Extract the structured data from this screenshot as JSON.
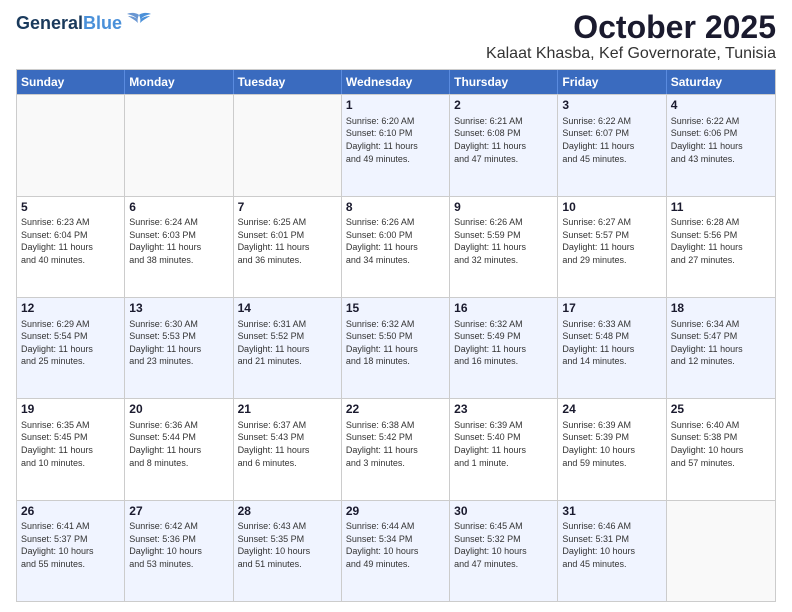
{
  "header": {
    "logo_line1": "General",
    "logo_line2": "Blue",
    "title": "October 2025",
    "subtitle": "Kalaat Khasba, Kef Governorate, Tunisia"
  },
  "calendar": {
    "weekdays": [
      "Sunday",
      "Monday",
      "Tuesday",
      "Wednesday",
      "Thursday",
      "Friday",
      "Saturday"
    ],
    "weeks": [
      [
        {
          "day": "",
          "info": ""
        },
        {
          "day": "",
          "info": ""
        },
        {
          "day": "",
          "info": ""
        },
        {
          "day": "1",
          "info": "Sunrise: 6:20 AM\nSunset: 6:10 PM\nDaylight: 11 hours\nand 49 minutes."
        },
        {
          "day": "2",
          "info": "Sunrise: 6:21 AM\nSunset: 6:08 PM\nDaylight: 11 hours\nand 47 minutes."
        },
        {
          "day": "3",
          "info": "Sunrise: 6:22 AM\nSunset: 6:07 PM\nDaylight: 11 hours\nand 45 minutes."
        },
        {
          "day": "4",
          "info": "Sunrise: 6:22 AM\nSunset: 6:06 PM\nDaylight: 11 hours\nand 43 minutes."
        }
      ],
      [
        {
          "day": "5",
          "info": "Sunrise: 6:23 AM\nSunset: 6:04 PM\nDaylight: 11 hours\nand 40 minutes."
        },
        {
          "day": "6",
          "info": "Sunrise: 6:24 AM\nSunset: 6:03 PM\nDaylight: 11 hours\nand 38 minutes."
        },
        {
          "day": "7",
          "info": "Sunrise: 6:25 AM\nSunset: 6:01 PM\nDaylight: 11 hours\nand 36 minutes."
        },
        {
          "day": "8",
          "info": "Sunrise: 6:26 AM\nSunset: 6:00 PM\nDaylight: 11 hours\nand 34 minutes."
        },
        {
          "day": "9",
          "info": "Sunrise: 6:26 AM\nSunset: 5:59 PM\nDaylight: 11 hours\nand 32 minutes."
        },
        {
          "day": "10",
          "info": "Sunrise: 6:27 AM\nSunset: 5:57 PM\nDaylight: 11 hours\nand 29 minutes."
        },
        {
          "day": "11",
          "info": "Sunrise: 6:28 AM\nSunset: 5:56 PM\nDaylight: 11 hours\nand 27 minutes."
        }
      ],
      [
        {
          "day": "12",
          "info": "Sunrise: 6:29 AM\nSunset: 5:54 PM\nDaylight: 11 hours\nand 25 minutes."
        },
        {
          "day": "13",
          "info": "Sunrise: 6:30 AM\nSunset: 5:53 PM\nDaylight: 11 hours\nand 23 minutes."
        },
        {
          "day": "14",
          "info": "Sunrise: 6:31 AM\nSunset: 5:52 PM\nDaylight: 11 hours\nand 21 minutes."
        },
        {
          "day": "15",
          "info": "Sunrise: 6:32 AM\nSunset: 5:50 PM\nDaylight: 11 hours\nand 18 minutes."
        },
        {
          "day": "16",
          "info": "Sunrise: 6:32 AM\nSunset: 5:49 PM\nDaylight: 11 hours\nand 16 minutes."
        },
        {
          "day": "17",
          "info": "Sunrise: 6:33 AM\nSunset: 5:48 PM\nDaylight: 11 hours\nand 14 minutes."
        },
        {
          "day": "18",
          "info": "Sunrise: 6:34 AM\nSunset: 5:47 PM\nDaylight: 11 hours\nand 12 minutes."
        }
      ],
      [
        {
          "day": "19",
          "info": "Sunrise: 6:35 AM\nSunset: 5:45 PM\nDaylight: 11 hours\nand 10 minutes."
        },
        {
          "day": "20",
          "info": "Sunrise: 6:36 AM\nSunset: 5:44 PM\nDaylight: 11 hours\nand 8 minutes."
        },
        {
          "day": "21",
          "info": "Sunrise: 6:37 AM\nSunset: 5:43 PM\nDaylight: 11 hours\nand 6 minutes."
        },
        {
          "day": "22",
          "info": "Sunrise: 6:38 AM\nSunset: 5:42 PM\nDaylight: 11 hours\nand 3 minutes."
        },
        {
          "day": "23",
          "info": "Sunrise: 6:39 AM\nSunset: 5:40 PM\nDaylight: 11 hours\nand 1 minute."
        },
        {
          "day": "24",
          "info": "Sunrise: 6:39 AM\nSunset: 5:39 PM\nDaylight: 10 hours\nand 59 minutes."
        },
        {
          "day": "25",
          "info": "Sunrise: 6:40 AM\nSunset: 5:38 PM\nDaylight: 10 hours\nand 57 minutes."
        }
      ],
      [
        {
          "day": "26",
          "info": "Sunrise: 6:41 AM\nSunset: 5:37 PM\nDaylight: 10 hours\nand 55 minutes."
        },
        {
          "day": "27",
          "info": "Sunrise: 6:42 AM\nSunset: 5:36 PM\nDaylight: 10 hours\nand 53 minutes."
        },
        {
          "day": "28",
          "info": "Sunrise: 6:43 AM\nSunset: 5:35 PM\nDaylight: 10 hours\nand 51 minutes."
        },
        {
          "day": "29",
          "info": "Sunrise: 6:44 AM\nSunset: 5:34 PM\nDaylight: 10 hours\nand 49 minutes."
        },
        {
          "day": "30",
          "info": "Sunrise: 6:45 AM\nSunset: 5:32 PM\nDaylight: 10 hours\nand 47 minutes."
        },
        {
          "day": "31",
          "info": "Sunrise: 6:46 AM\nSunset: 5:31 PM\nDaylight: 10 hours\nand 45 minutes."
        },
        {
          "day": "",
          "info": ""
        }
      ]
    ]
  }
}
